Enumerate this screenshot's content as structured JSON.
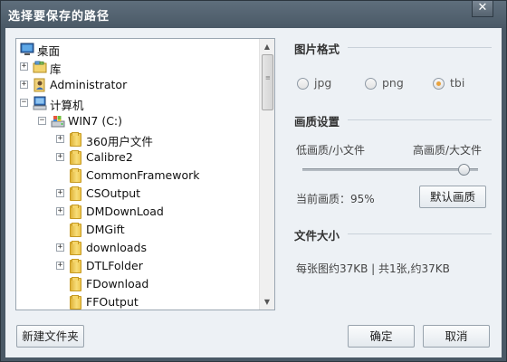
{
  "window": {
    "title": "选择要保存的路径",
    "close_glyph": "✕"
  },
  "tree": {
    "nodes": [
      {
        "label": "桌面",
        "icon": "desktop-icon",
        "expander": ""
      },
      {
        "label": "库",
        "icon": "library-icon",
        "expander": "+"
      },
      {
        "label": "Administrator",
        "icon": "user-icon",
        "expander": "+"
      },
      {
        "label": "计算机",
        "icon": "computer-icon",
        "expander": "−"
      },
      {
        "label": "WIN7 (C:)",
        "icon": "drive-icon",
        "expander": "−"
      },
      {
        "label": "360用户文件",
        "icon": "folder-icon",
        "expander": "+"
      },
      {
        "label": "Calibre2",
        "icon": "folder-icon",
        "expander": "+"
      },
      {
        "label": "CommonFramework",
        "icon": "folder-icon",
        "expander": ""
      },
      {
        "label": "CSOutput",
        "icon": "folder-icon",
        "expander": "+"
      },
      {
        "label": "DMDownLoad",
        "icon": "folder-icon",
        "expander": "+"
      },
      {
        "label": "DMGift",
        "icon": "folder-icon",
        "expander": ""
      },
      {
        "label": "downloads",
        "icon": "folder-icon",
        "expander": "+"
      },
      {
        "label": "DTLFolder",
        "icon": "folder-icon",
        "expander": "+"
      },
      {
        "label": "FDownload",
        "icon": "folder-icon",
        "expander": ""
      },
      {
        "label": "FFOutput",
        "icon": "folder-icon",
        "expander": ""
      }
    ]
  },
  "format": {
    "title": "图片格式",
    "options": [
      {
        "label": "jpg",
        "checked": false
      },
      {
        "label": "png",
        "checked": false
      },
      {
        "label": "tbi",
        "checked": true
      }
    ]
  },
  "quality": {
    "title": "画质设置",
    "low_label": "低画质/小文件",
    "high_label": "高画质/大文件",
    "value_percent": 95,
    "current_text": "当前画质：95%",
    "default_button": "默认画质"
  },
  "filesize": {
    "title": "文件大小",
    "summary": "每张图约37KB | 共1张,约37KB"
  },
  "buttons": {
    "new_folder": "新建文件夹",
    "ok": "确定",
    "cancel": "取消"
  },
  "colors": {
    "accent_radio": "#e8a23d",
    "titlebar": "#4a5966"
  }
}
